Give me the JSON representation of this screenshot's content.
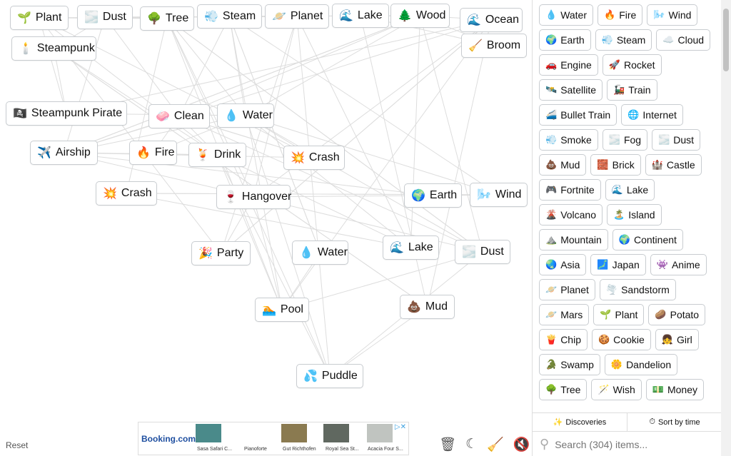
{
  "canvas_items": [
    {
      "label": "Plant",
      "icon": "🌱"
    },
    {
      "label": "Dust",
      "icon": "🌫️"
    },
    {
      "label": "Tree",
      "icon": "🌳"
    },
    {
      "label": "Steam",
      "icon": "💨"
    },
    {
      "label": "Planet",
      "icon": "🪐"
    },
    {
      "label": "Lake",
      "icon": "🌊"
    },
    {
      "label": "Wood",
      "icon": "🌲"
    },
    {
      "label": "Ocean",
      "icon": "🌊"
    },
    {
      "label": "Broom",
      "icon": "🧹"
    },
    {
      "label": "Steampunk",
      "icon": "🕯️"
    },
    {
      "label": "Steampunk Pirate",
      "icon": "🏴‍☠️"
    },
    {
      "label": "Clean",
      "icon": "🧼"
    },
    {
      "label": "Water",
      "icon": "💧"
    },
    {
      "label": "Airship",
      "icon": "✈️"
    },
    {
      "label": "Fire",
      "icon": "🔥"
    },
    {
      "label": "Drink",
      "icon": "🍹"
    },
    {
      "label": "Crash",
      "icon": "💥"
    },
    {
      "label": "Crash",
      "icon": "💥"
    },
    {
      "label": "Hangover",
      "icon": "🍷"
    },
    {
      "label": "Earth",
      "icon": "🌍"
    },
    {
      "label": "Wind",
      "icon": "🌬️"
    },
    {
      "label": "Party",
      "icon": "🎉"
    },
    {
      "label": "Water",
      "icon": "💧"
    },
    {
      "label": "Lake",
      "icon": "🌊"
    },
    {
      "label": "Dust",
      "icon": "🌫️"
    },
    {
      "label": "Pool",
      "icon": "🏊"
    },
    {
      "label": "Mud",
      "icon": "💩"
    },
    {
      "label": "Puddle",
      "icon": "💦"
    }
  ],
  "sidebar_items": [
    {
      "label": "Water",
      "icon": "💧"
    },
    {
      "label": "Fire",
      "icon": "🔥"
    },
    {
      "label": "Wind",
      "icon": "🌬️"
    },
    {
      "label": "Earth",
      "icon": "🌍"
    },
    {
      "label": "Steam",
      "icon": "💨"
    },
    {
      "label": "Cloud",
      "icon": "☁️"
    },
    {
      "label": "Engine",
      "icon": "🚗"
    },
    {
      "label": "Rocket",
      "icon": "🚀"
    },
    {
      "label": "Satellite",
      "icon": "🛰️"
    },
    {
      "label": "Train",
      "icon": "🚂"
    },
    {
      "label": "Bullet Train",
      "icon": "🚄"
    },
    {
      "label": "Internet",
      "icon": "🌐"
    },
    {
      "label": "Smoke",
      "icon": "💨"
    },
    {
      "label": "Fog",
      "icon": "🌫️"
    },
    {
      "label": "Dust",
      "icon": "🌫️"
    },
    {
      "label": "Mud",
      "icon": "💩"
    },
    {
      "label": "Brick",
      "icon": "🧱"
    },
    {
      "label": "Castle",
      "icon": "🏰"
    },
    {
      "label": "Fortnite",
      "icon": "🎮"
    },
    {
      "label": "Lake",
      "icon": "🌊"
    },
    {
      "label": "Volcano",
      "icon": "🌋"
    },
    {
      "label": "Island",
      "icon": "🏝️"
    },
    {
      "label": "Mountain",
      "icon": "⛰️"
    },
    {
      "label": "Continent",
      "icon": "🌍"
    },
    {
      "label": "Asia",
      "icon": "🌏"
    },
    {
      "label": "Japan",
      "icon": "🗾"
    },
    {
      "label": "Anime",
      "icon": "👾"
    },
    {
      "label": "Planet",
      "icon": "🪐"
    },
    {
      "label": "Sandstorm",
      "icon": "🌪️"
    },
    {
      "label": "Mars",
      "icon": "🪐"
    },
    {
      "label": "Plant",
      "icon": "🌱"
    },
    {
      "label": "Potato",
      "icon": "🥔"
    },
    {
      "label": "Chip",
      "icon": "🍟"
    },
    {
      "label": "Cookie",
      "icon": "🍪"
    },
    {
      "label": "Girl",
      "icon": "👧"
    },
    {
      "label": "Swamp",
      "icon": "🐊"
    },
    {
      "label": "Dandelion",
      "icon": "🌼"
    },
    {
      "label": "Tree",
      "icon": "🌳"
    },
    {
      "label": "Wish",
      "icon": "🪄"
    },
    {
      "label": "Money",
      "icon": "💵"
    }
  ],
  "tabs": {
    "discoveries": "Discoveries",
    "sort": "Sort by time"
  },
  "search": {
    "placeholder": "Search (304) items..."
  },
  "reset": "Reset",
  "ad": {
    "brand": "Booking.com",
    "captions": [
      "Sasa Safari C...",
      "Pianoforte",
      "Gut Richthofen",
      "Royal Sea St...",
      "Acacia Four S..."
    ]
  }
}
